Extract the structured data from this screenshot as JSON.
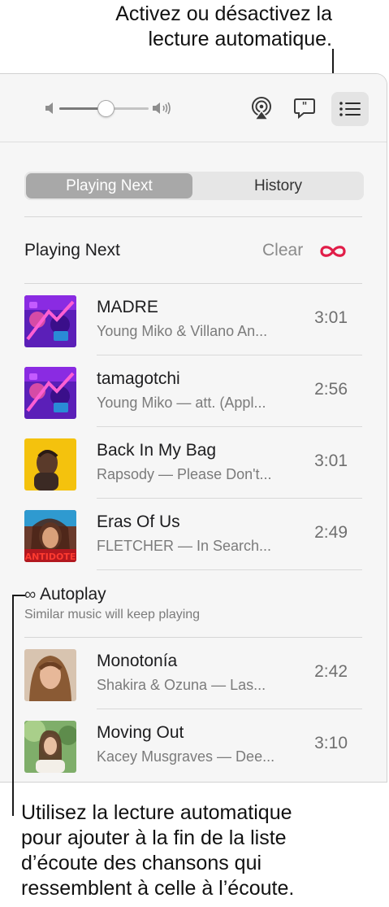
{
  "annotations": {
    "top": [
      "Activez ou désactivez la",
      "lecture automatique."
    ],
    "bottom": [
      "Utilisez la lecture automatique",
      "pour ajouter à la fin de la liste",
      "d’écoute des chansons qui",
      "ressemblent à celle à l’écoute."
    ]
  },
  "toolbar": {
    "volume_level": 0.52,
    "icons": [
      "volume-low-icon",
      "volume-high-icon",
      "airplay-icon",
      "lyrics-icon",
      "queue-list-icon"
    ]
  },
  "tabs": {
    "playing_next": "Playing Next",
    "history": "History"
  },
  "playing_next": {
    "title": "Playing Next",
    "clear_label": "Clear",
    "autoplay_icon": "infinity-icon",
    "autoplay_color": "#e11d48",
    "songs": [
      {
        "title": "MADRE",
        "subtitle": "Young Miko & Villano An...",
        "duration": "3:01"
      },
      {
        "title": "tamagotchi",
        "subtitle": "Young Miko — att. (Appl...",
        "duration": "2:56"
      },
      {
        "title": "Back In My Bag",
        "subtitle": "Rapsody — Please Don't...",
        "duration": "3:01"
      },
      {
        "title": "Eras Of Us",
        "subtitle": "FLETCHER — In Search...",
        "duration": "2:49"
      }
    ]
  },
  "autoplay": {
    "title": "Autoplay",
    "subtitle": "Similar music will keep playing",
    "songs": [
      {
        "title": "Monotonía",
        "subtitle": "Shakira & Ozuna — Las...",
        "duration": "2:42"
      },
      {
        "title": "Moving Out",
        "subtitle": "Kacey Musgraves — Dee...",
        "duration": "3:10"
      }
    ]
  },
  "art_labels": {
    "eras_of_us": "ANTIDOTE"
  }
}
